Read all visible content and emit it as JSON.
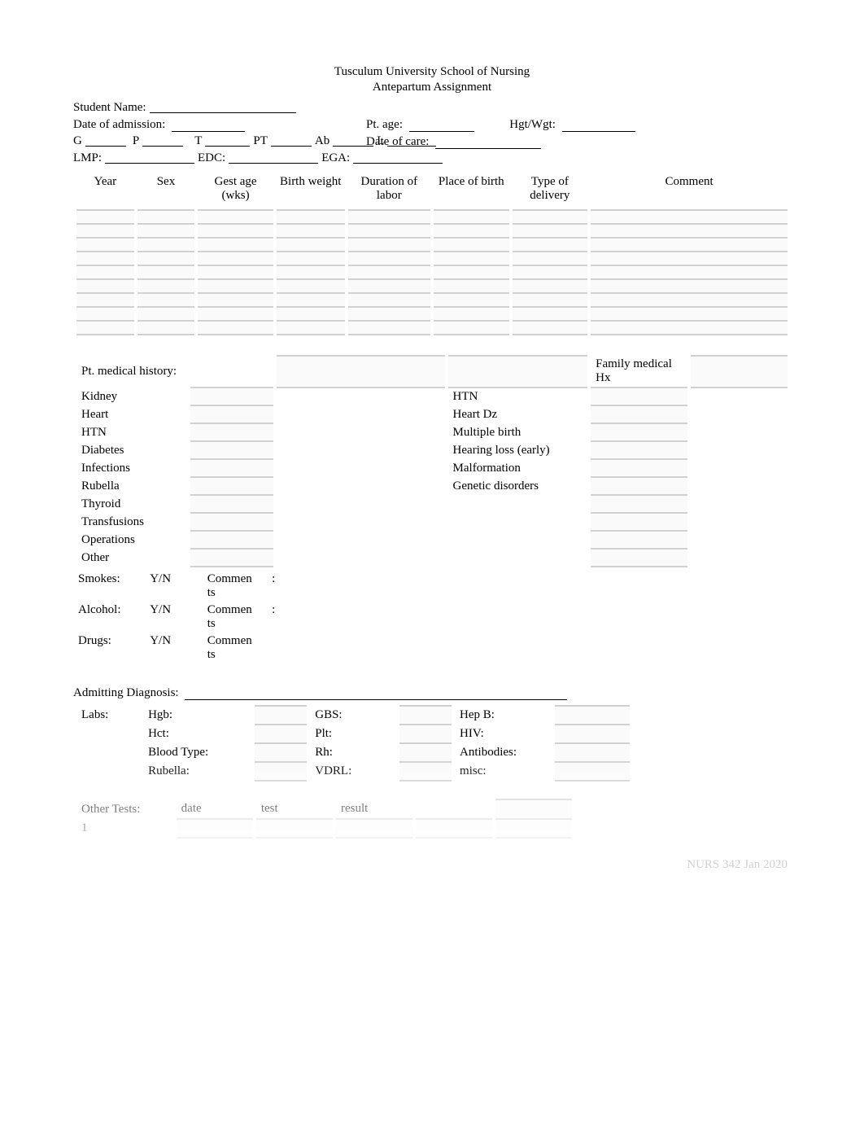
{
  "header": {
    "line1": "Tusculum University School of Nursing",
    "line2": "Antepartum Assignment"
  },
  "info": {
    "student_name_label": "Student Name:",
    "date_admission_label": "Date of admission:",
    "pt_age_label": "Pt. age:",
    "hgt_wgt_label": "Hgt/Wgt:",
    "date_care_label": "Date of care:",
    "g_label": "G",
    "p_label": "P",
    "t_label": "T",
    "pt_label": "PT",
    "ab_label": "Ab",
    "l_label": "L",
    "lmp_label": "LMP:",
    "edc_label": "EDC:",
    "ega_label": "EGA:"
  },
  "grid": {
    "headers": [
      "Year",
      "Sex",
      "Gest age (wks)",
      "Birth weight",
      "Duration of labor",
      "Place of birth",
      "Type of delivery",
      "Comment"
    ]
  },
  "med_history": {
    "section_left": "Pt. medical history:",
    "section_right": "Family medical Hx",
    "left_items": [
      "Kidney",
      "Heart",
      "HTN",
      "Diabetes",
      "Infections",
      "Rubella",
      "Thyroid",
      "Transfusions",
      "Operations",
      "Other"
    ],
    "right_items": [
      "HTN",
      "Heart Dz",
      "Multiple birth",
      "Hearing loss (early)",
      "Malformation",
      "Genetic disorders"
    ]
  },
  "substances": {
    "rows": [
      {
        "label": "Smokes:",
        "yn": "Y/N",
        "comments_label": "Commen ts",
        "colon": ":"
      },
      {
        "label": "Alcohol:",
        "yn": "Y/N",
        "comments_label": "Commen ts",
        "colon": ":"
      },
      {
        "label": "Drugs:",
        "yn": "Y/N",
        "comments_label": "Commen ts",
        "colon": ""
      }
    ]
  },
  "admitting_dx_label": "Admitting Diagnosis:",
  "labs": {
    "label": "Labs:",
    "col1": [
      "Hgb:",
      "Hct:",
      "Blood Type:",
      "Rubella:"
    ],
    "col2": [
      "GBS:",
      "Plt:",
      "Rh:",
      "VDRL:"
    ],
    "col3": [
      "Hep B:",
      "HIV:",
      "Antibodies:",
      "misc:"
    ]
  },
  "other_tests": {
    "label": "Other Tests:",
    "headers": [
      "date",
      "test",
      "result"
    ],
    "row1": "1"
  },
  "footer": "NURS 342 Jan 2020"
}
